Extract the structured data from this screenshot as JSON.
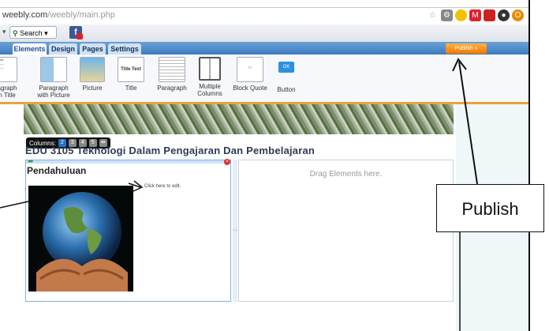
{
  "browser": {
    "url_host": "weebly.com",
    "url_path": "/weebly/main.php",
    "search_label": "Search",
    "icons": [
      "star-icon",
      "extension-icon",
      "pacman-icon",
      "gmail-icon",
      "bookmark-icon",
      "chrome-icon",
      "opera-icon"
    ]
  },
  "tabs": [
    {
      "label": "Elements"
    },
    {
      "label": "Design"
    },
    {
      "label": "Pages"
    },
    {
      "label": "Settings"
    }
  ],
  "publish_label": "Publish »",
  "elements": [
    {
      "label": "agraph\nh Title",
      "icon": "paragraph-with-title-icon"
    },
    {
      "label": "Paragraph\nwith Picture",
      "icon": "paragraph-with-picture-icon"
    },
    {
      "label": "Picture",
      "icon": "picture-icon"
    },
    {
      "label": "Title",
      "thumb_text": "Title Text",
      "icon": "title-icon"
    },
    {
      "label": "Paragraph",
      "icon": "paragraph-icon"
    },
    {
      "label": "Multiple\nColumns",
      "icon": "multiple-columns-icon"
    },
    {
      "label": "Block Quote",
      "icon": "block-quote-icon"
    },
    {
      "label": "Button",
      "thumb_text": "OK",
      "icon": "button-icon"
    }
  ],
  "columns_bar": {
    "label": "Columns:",
    "options": [
      "2",
      "3",
      "4",
      "5"
    ],
    "selected": "2"
  },
  "page_title": "EDU 3105 Teknologi Dalam Pengajaran Dan Pembelajaran",
  "section_heading": "Pendahuluan",
  "click_to_edit": "Click here to edit.",
  "drag_text": "Drag Elements here.",
  "callout_label": "Publish",
  "colors": {
    "tabbar": "#3e7bbf",
    "publish": "#f07800",
    "accent_border": "#e8a43a"
  }
}
